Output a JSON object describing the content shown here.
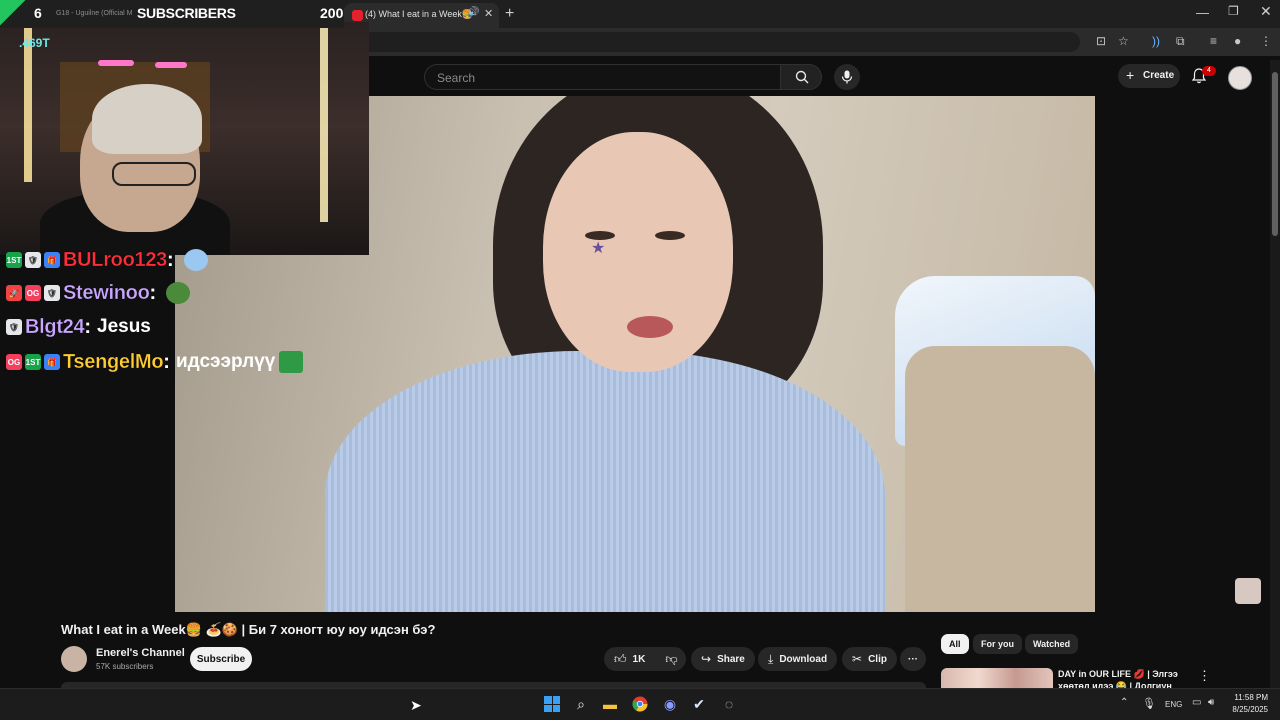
{
  "stream_overlay": {
    "sub_count": "6",
    "now_playing": "G18 - Uguilne (Official M",
    "label": "SUBSCRIBERS",
    "goal": "200",
    "cam_stat": ".469T",
    "chat": [
      {
        "badges": [
          "1ST",
          "🛡",
          "🎁"
        ],
        "user": "BULroo123",
        "user_color": "#ff2d3a",
        "message": ""
      },
      {
        "badges": [
          "🚀",
          "OG",
          "🛡"
        ],
        "user": "Stewinoo",
        "user_color": "#c9a6ff",
        "message": ""
      },
      {
        "badges": [
          "🛡"
        ],
        "user": "Blgt24",
        "user_color": "#c9a6ff",
        "message": "Jesus"
      },
      {
        "badges": [
          "OG",
          "1ST",
          "🎁"
        ],
        "user": "TsengelMo",
        "user_color": "#ffcc33",
        "message": "идсээрлүү"
      }
    ]
  },
  "browser": {
    "tab_title": "(4) What I eat in a Week🍔",
    "new_tab_icon": "plus-icon",
    "window_controls": [
      "—",
      "❐",
      "✕"
    ]
  },
  "youtube": {
    "search_placeholder": "Search",
    "create_label": "Create",
    "notification_count": "4",
    "video_title": "What I eat in a Week🍔 🍝🍪 | Би 7 хоногт юу юу идсэн бэ?",
    "channel_name": "Enerel's Channel",
    "channel_subs": "57K subscribers",
    "subscribe_label": "Subscribe",
    "like_count": "1K",
    "share_label": "Share",
    "download_label": "Download",
    "clip_label": "Clip",
    "more_label": "···",
    "chips": [
      "All",
      "For you",
      "Watched"
    ],
    "recommendation": {
      "title": "DAY in OUR LIFE 💋 | Элгээ",
      "title2": "хөөтөл идээ 😂 | Долгиун"
    }
  },
  "taskbar": {
    "language": "ENG",
    "time": "11:58 PM",
    "date": "8/25/2025"
  },
  "colors": {
    "youtube_bg": "#0f0f0f",
    "accent_red": "#cc0000",
    "chip_active": "#f1f1f1"
  }
}
